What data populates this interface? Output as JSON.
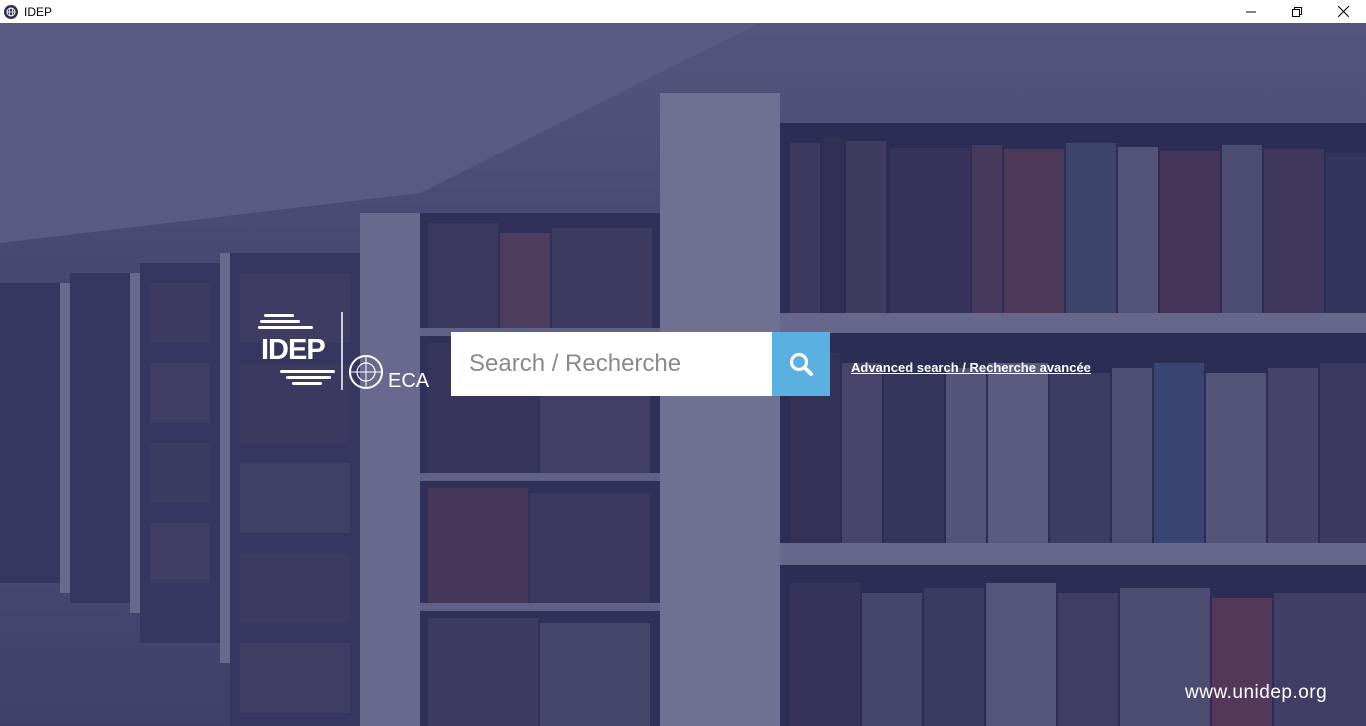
{
  "window": {
    "title": "IDEP",
    "icon": "app-globe-icon",
    "controls": [
      "minimize-icon",
      "restore-icon",
      "close-icon"
    ]
  },
  "logo": {
    "text": "IDEP",
    "partner": "ECA",
    "emblem": "un-emblem-icon"
  },
  "search": {
    "placeholder": "Search / Recherche",
    "value": "",
    "button_icon": "search-icon"
  },
  "advanced_link": "Advanced search / Recherche avancée",
  "site_url": "www.unidep.org",
  "colors": {
    "accent": "#5ab0e0",
    "overlay": "#262652"
  }
}
